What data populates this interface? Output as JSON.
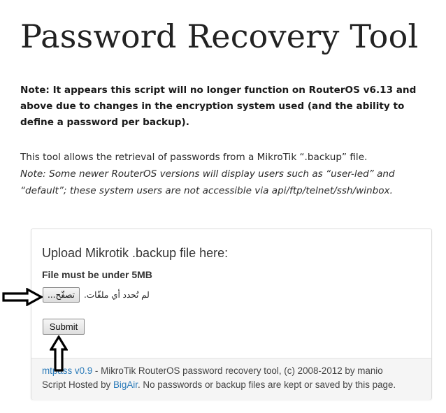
{
  "page": {
    "title": "Password Recovery Tool",
    "note_bold": "Note: It appears this script will no longer function on RouterOS v6.13 and above due to changes in the encryption system used (and the ability to define a password per backup).",
    "intro_text": "This tool allows the retrieval of passwords from a MikroTik “.backup” file.",
    "intro_note": "Note: Some newer RouterOS versions will display users such as “user-led” and “default”; these system users are not accessible via api/ftp/telnet/ssh/winbox."
  },
  "upload": {
    "heading": "Upload Mikrotik .backup file here:",
    "size_note": "File must be under 5MB",
    "browse_label": "تصفّح...",
    "no_file_text": "لم تُحدد أي ملفّات.",
    "submit_label": "Submit"
  },
  "footer": {
    "app_link": "mtpass v0.9",
    "app_desc": " - MikroTik RouterOS password recovery tool, (c) 2008-2012 by manio",
    "hosted_prefix": "Script Hosted by ",
    "host_link": "BigAir",
    "hosted_suffix": ". No passwords or backup files are kept or saved by this page."
  },
  "colors": {
    "link": "#2b7bb9",
    "footer_bg": "#f5f5f5",
    "annotation_arrow": "#000000"
  },
  "icons": {
    "annotation_right": "arrow-right-outline-icon",
    "annotation_up": "arrow-up-outline-icon"
  }
}
